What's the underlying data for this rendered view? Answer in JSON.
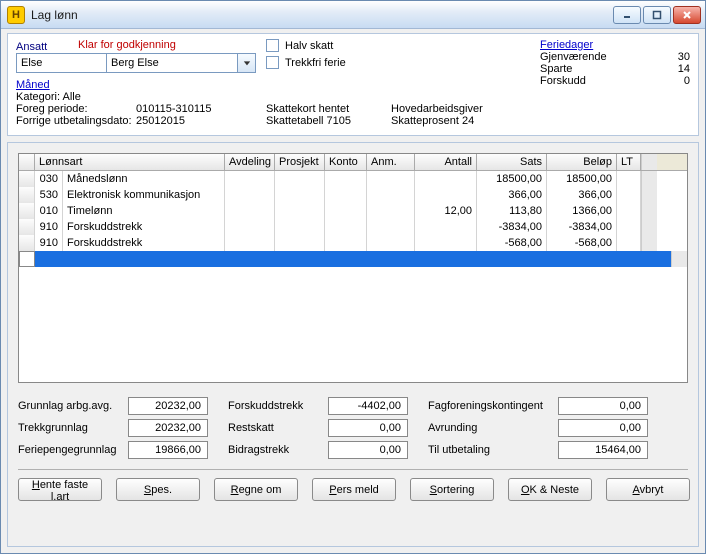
{
  "window": {
    "title": "Lag lønn",
    "appicon_letter": "H"
  },
  "header": {
    "ansatt_label": "Ansatt",
    "status_text": "Klar for godkjenning",
    "employee_code": "Else",
    "employee_name": "Berg Else",
    "maned": "Måned",
    "kategori": "Kategori: Alle",
    "foreg_periode_label": "Foreg periode:",
    "foreg_periode_value": "010115-310115",
    "forrige_utb_label": "Forrige utbetalingsdato:",
    "forrige_utb_value": "25012015",
    "halv_skatt_label": "Halv skatt",
    "trekkfri_ferie_label": "Trekkfri ferie",
    "skattekort_hentet": "Skattekort hentet",
    "skattetabell": "Skattetabell 7105",
    "hovedarbeidsgiver": "Hovedarbeidsgiver",
    "skatteprosent": "Skatteprosent 24",
    "feriedager": {
      "title": "Feriedager",
      "gjenvaerende_label": "Gjenværende",
      "gjenvaerende_value": "30",
      "sparte_label": "Sparte",
      "sparte_value": "14",
      "forskudd_label": "Forskudd",
      "forskudd_value": "0"
    }
  },
  "grid": {
    "headers": [
      "",
      "Lønnsart",
      "Avdeling",
      "Prosjekt",
      "Konto",
      "Anm.",
      "Antall",
      "Sats",
      "Beløp",
      "LT"
    ],
    "rows": [
      {
        "code": "030",
        "art": "Månedslønn",
        "avd": "",
        "prosj": "",
        "konto": "",
        "anm": "",
        "antall": "",
        "sats": "18500,00",
        "belop": "18500,00",
        "lt": ""
      },
      {
        "code": "530",
        "art": "Elektronisk kommunikasjon",
        "avd": "",
        "prosj": "",
        "konto": "",
        "anm": "",
        "antall": "",
        "sats": "366,00",
        "belop": "366,00",
        "lt": ""
      },
      {
        "code": "010",
        "art": "Timelønn",
        "avd": "",
        "prosj": "",
        "konto": "",
        "anm": "",
        "antall": "12,00",
        "sats": "113,80",
        "belop": "1366,00",
        "lt": ""
      },
      {
        "code": "910",
        "art": "Forskuddstrekk",
        "avd": "",
        "prosj": "",
        "konto": "",
        "anm": "",
        "antall": "",
        "sats": "-3834,00",
        "belop": "-3834,00",
        "lt": ""
      },
      {
        "code": "910",
        "art": "Forskuddstrekk",
        "avd": "",
        "prosj": "",
        "konto": "",
        "anm": "",
        "antall": "",
        "sats": "-568,00",
        "belop": "-568,00",
        "lt": ""
      }
    ]
  },
  "totals": {
    "grunnlag_label": "Grunnlag arbg.avg.",
    "grunnlag_value": "20232,00",
    "trekkgrunnlag_label": "Trekkgrunnlag",
    "trekkgrunnlag_value": "20232,00",
    "feriepenge_label": "Feriepengegrunnlag",
    "feriepenge_value": "19866,00",
    "forskudd_label": "Forskuddstrekk",
    "forskudd_value": "-4402,00",
    "restskatt_label": "Restskatt",
    "restskatt_value": "0,00",
    "bidrag_label": "Bidragstrekk",
    "bidrag_value": "0,00",
    "fagforening_label": "Fagforeningskontingent",
    "fagforening_value": "0,00",
    "avrunding_label": "Avrunding",
    "avrunding_value": "0,00",
    "tilutbetaling_label": "Til utbetaling",
    "tilutbetaling_value": "15464,00"
  },
  "buttons": {
    "hente": "Hente faste l.art",
    "spes": "Spes.",
    "regne": "Regne om",
    "pers": "Pers meld",
    "sort": "Sortering",
    "okneste": "OK & Neste",
    "avbryt": "Avbryt"
  }
}
